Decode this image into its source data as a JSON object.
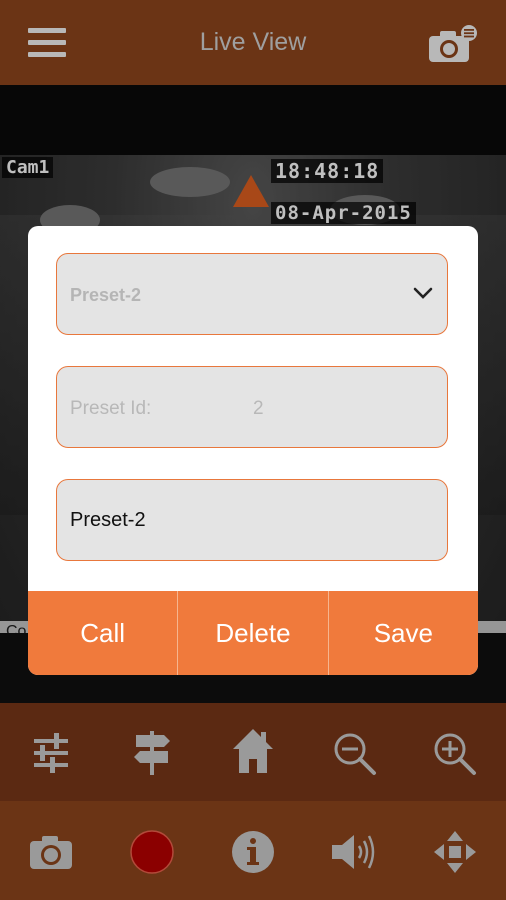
{
  "app": {
    "title": "Live View"
  },
  "video": {
    "camera_label": "Cam1",
    "time": "18:48:18",
    "date": "08-Apr-2015",
    "status_text": "Co"
  },
  "dialog": {
    "preset_select": {
      "value": "Preset-2"
    },
    "preset_id": {
      "label": "Preset Id:",
      "value": "2"
    },
    "preset_name": {
      "value": "Preset-2"
    },
    "buttons": {
      "call": "Call",
      "delete": "Delete",
      "save": "Save"
    }
  },
  "control_bar": {
    "icons": [
      "settings-sliders-icon",
      "signpost-icon",
      "home-icon",
      "zoom-out-icon",
      "zoom-in-icon"
    ]
  },
  "bottom_bar": {
    "icons": [
      "camera-icon",
      "record-icon",
      "info-icon",
      "speaker-icon",
      "ptz-move-icon"
    ]
  },
  "colors": {
    "top_bar": "#6b3415",
    "accent": "#f07a3c",
    "control_bar": "#5b2912",
    "record": "#8b0000"
  }
}
